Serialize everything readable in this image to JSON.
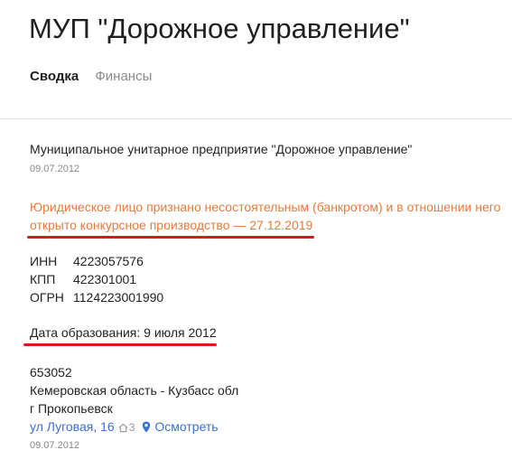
{
  "header": {
    "title": "МУП \"Дорожное управление\""
  },
  "tabs": [
    {
      "label": "Сводка",
      "active": true
    },
    {
      "label": "Финансы",
      "active": false
    }
  ],
  "summary": {
    "full_name": "Муниципальное унитарное предприятие \"Дорожное управление\"",
    "full_name_date": "09.07.2012",
    "status_text": "Юридическое лицо признано несостоятельным (банкротом) и в отношении него открыто конкурсное производство — 27.12.2019",
    "status_color": "#e87a3e",
    "identifiers": [
      {
        "label": "ИНН",
        "value": "4223057576"
      },
      {
        "label": "КПП",
        "value": "422301001"
      },
      {
        "label": "ОГРН",
        "value": "1124223001990"
      }
    ],
    "registration": "Дата образования: 9 июля 2012",
    "address": {
      "postal_code": "653052",
      "region": "Кемеровская область - Кузбасс обл",
      "city": "г Прокопьевск",
      "street": "ул Луговая, 16",
      "house_count": "3",
      "map_link": "Осмотреть",
      "date": "09.07.2012"
    }
  },
  "colors": {
    "link": "#3a6fd6",
    "annotation_underline": "#e0161b"
  },
  "icons": [
    "house-icon",
    "map-pin-icon"
  ]
}
